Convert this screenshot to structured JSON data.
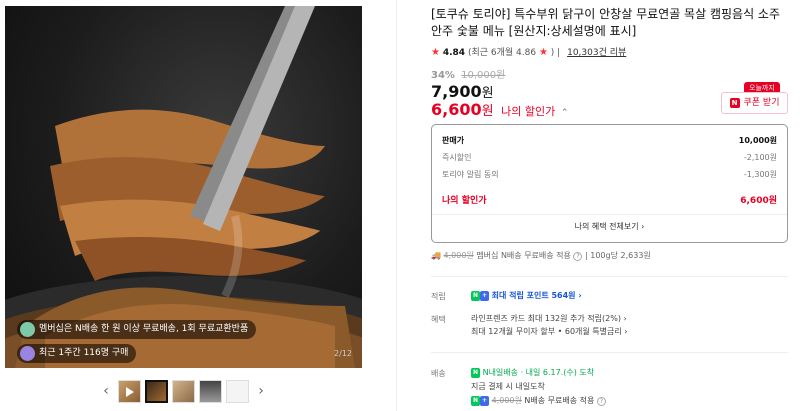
{
  "gallery": {
    "badge1": "멤버십은 N배송 한 원 이상 무료배송, 1회 무료교환반품",
    "badge2": "최근 1주간 116명 구매",
    "counter": "2/12",
    "prev_arrow": "‹",
    "next_arrow": "›"
  },
  "product": {
    "title": "[토쿠슈 토리야] 특수부위 닭구이 안창살 무료연골 목살 캠핑음식 소주안주 숯불 메뉴 [원산지:상세설명에 표시]",
    "rating_score": "4.84",
    "rating_recent": "(최근 6개월 4.86",
    "review_count": "10,303건 리뷰",
    "discount_pct": "34%",
    "original_price": "10,000원",
    "sale_price": "7,900",
    "sale_unit": "원",
    "my_price": "6,600",
    "my_unit": "원",
    "my_price_label": "나의 할인가",
    "today_tag": "오늘까지",
    "coupon_label": "쿠폰 받기"
  },
  "price_box": {
    "rows": [
      {
        "label": "판매가",
        "value": "10,000원"
      },
      {
        "label": "즉시할인",
        "value": "-2,100원"
      },
      {
        "label": "토리야 알림 동의",
        "value": "-1,300원"
      }
    ],
    "my_label": "나의 할인가",
    "my_value": "6,600원",
    "all_benefits": "나의 혜택 전체보기 ›"
  },
  "shipping_top": {
    "strike": "4,000원",
    "text": " 멤버십 N배송 무료배송 적용",
    "unit": "100g당 2,633원"
  },
  "benefits": {
    "points_label": "적립",
    "points_text": "최대 적립 포인트 564원 ›",
    "perks_label": "혜택",
    "perk1": "라인프렌즈 카드 최대 132원 추가 적립(2%) ›",
    "perk2": "최대 12개월 무이자 할부 • 60개월 특별금리 ›",
    "delivery_label": "배송",
    "delivery_badge": "N내일배송",
    "delivery_date": "· 내일 6.17.(수) 도착",
    "delivery_note": "지금 결제 시 내일도착",
    "delivery_fee_strike": "4,000원",
    "delivery_fee_text": " N배송 무료배송 적용"
  },
  "colors": {
    "accent": "#e60023",
    "npay": "#03c75a",
    "membership": "#3d6bea"
  }
}
